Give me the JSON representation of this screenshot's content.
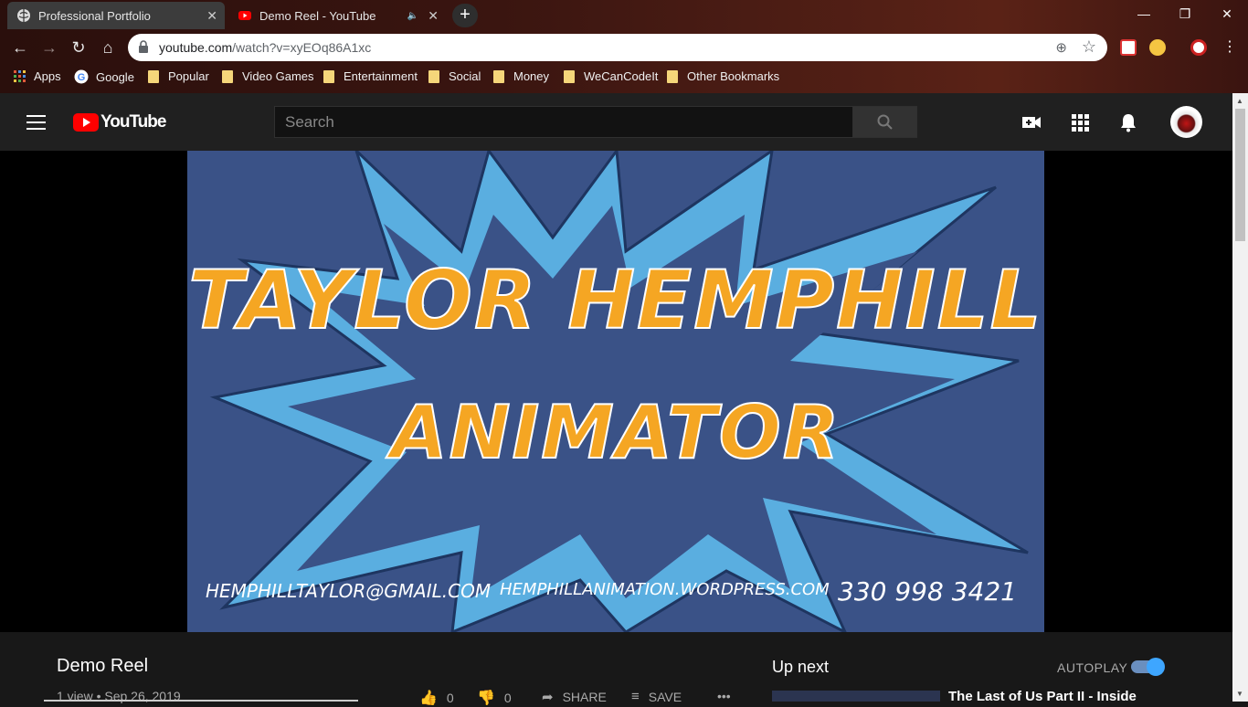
{
  "browser": {
    "tabs": [
      {
        "title": "Professional Portfolio",
        "active": true
      },
      {
        "title": "Demo Reel - YouTube",
        "active": false
      }
    ],
    "url_host": "youtube.com",
    "url_path": "/watch?v=xyEOq86A1xc",
    "bookmarks": [
      "Apps",
      "Google",
      "Popular",
      "Video Games",
      "Entertainment",
      "Social",
      "Money",
      "WeCanCodeIt",
      "Other Bookmarks"
    ]
  },
  "youtube": {
    "logo_text": "YouTube",
    "search_placeholder": "Search"
  },
  "video_frame": {
    "line1": "TAYLOR HEMPHILL",
    "line2": "ANIMATOR",
    "email": "HEMPHILLTAYLOR@GMAIL.COM",
    "website": "HEMPHILLANIMATION.WORDPRESS.COM",
    "phone": "330 998 3421"
  },
  "video_info": {
    "title": "Demo Reel",
    "meta": "1 view • Sep 26, 2019",
    "likes": "0",
    "dislikes": "0",
    "share_label": "SHARE",
    "save_label": "SAVE"
  },
  "sidebar": {
    "up_next_label": "Up next",
    "autoplay_label": "AUTOPLAY",
    "autoplay_on": true,
    "next_video_title": "The Last of Us Part II - Inside"
  },
  "colors": {
    "youtube_red": "#ff0000",
    "frame_blue": "#3a5287",
    "burst_blue": "#5aaee0",
    "title_orange": "#f5a623",
    "autoplay_blue": "#3ea6ff"
  }
}
